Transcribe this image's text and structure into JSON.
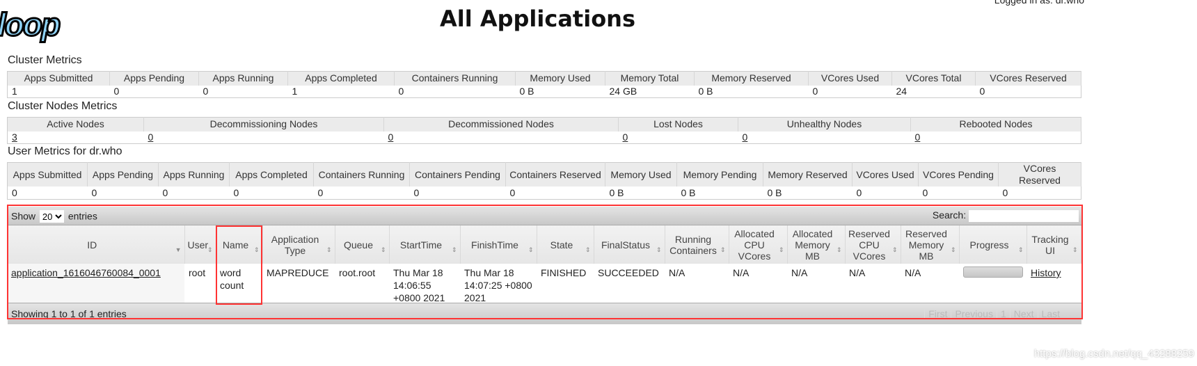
{
  "logo_text": "loop",
  "title": "All Applications",
  "logged_in": "Logged in as: dr.who",
  "cluster_metrics": {
    "heading": "Cluster Metrics",
    "headers": [
      "Apps Submitted",
      "Apps Pending",
      "Apps Running",
      "Apps Completed",
      "Containers Running",
      "Memory Used",
      "Memory Total",
      "Memory Reserved",
      "VCores Used",
      "VCores Total",
      "VCores Reserved"
    ],
    "values": [
      "1",
      "0",
      "0",
      "1",
      "0",
      "0 B",
      "24 GB",
      "0 B",
      "0",
      "24",
      "0"
    ]
  },
  "cluster_nodes": {
    "heading": "Cluster Nodes Metrics",
    "headers": [
      "Active Nodes",
      "Decommissioning Nodes",
      "Decommissioned Nodes",
      "Lost Nodes",
      "Unhealthy Nodes",
      "Rebooted Nodes"
    ],
    "values": [
      "3",
      "0",
      "0",
      "0",
      "0",
      "0"
    ]
  },
  "user_metrics": {
    "heading": "User Metrics for dr.who",
    "headers": [
      "Apps Submitted",
      "Apps Pending",
      "Apps Running",
      "Apps Completed",
      "Containers Running",
      "Containers Pending",
      "Containers Reserved",
      "Memory Used",
      "Memory Pending",
      "Memory Reserved",
      "VCores Used",
      "VCores Pending",
      "VCores Reserved"
    ],
    "values": [
      "0",
      "0",
      "0",
      "0",
      "0",
      "0",
      "0",
      "0 B",
      "0 B",
      "0 B",
      "0",
      "0",
      "0"
    ]
  },
  "apps": {
    "show": "Show",
    "entries_value": "20",
    "entries": "entries",
    "search_label": "Search:",
    "search_value": "",
    "headers": [
      "ID",
      "User",
      "Name",
      "Application Type",
      "Queue",
      "StartTime",
      "FinishTime",
      "State",
      "FinalStatus",
      "Running Containers",
      "Allocated CPU VCores",
      "Allocated Memory MB",
      "Reserved CPU VCores",
      "Reserved Memory MB",
      "Progress",
      "Tracking UI"
    ],
    "rows": [
      {
        "cells": [
          "application_1616046760084_0001",
          "root",
          "word count",
          "MAPREDUCE",
          "root.root",
          "Thu Mar 18 14:06:55 +0800 2021",
          "Thu Mar 18 14:07:25 +0800 2021",
          "FINISHED",
          "SUCCEEDED",
          "N/A",
          "N/A",
          "N/A",
          "N/A",
          "N/A",
          "",
          "History"
        ],
        "progress": 100
      }
    ],
    "info": "Showing 1 to 1 of 1 entries",
    "pager": [
      "First",
      "Previous",
      "1",
      "Next",
      "Last"
    ]
  },
  "watermark": "https://blog.csdn.net/qq_43288259",
  "colors": {
    "highlight": "#ff3333",
    "logo": "#8fd3f7"
  }
}
